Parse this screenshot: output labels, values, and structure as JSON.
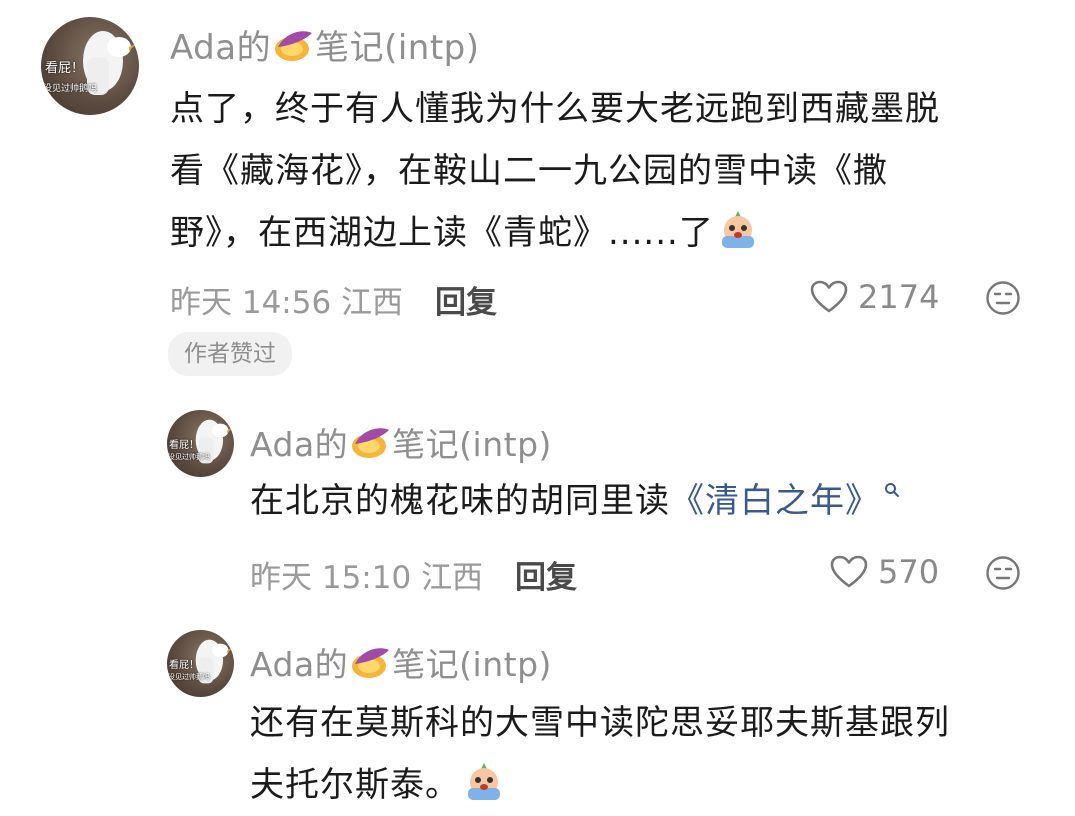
{
  "comments": [
    {
      "avatar": {
        "caption_top": "看屁！",
        "caption_bottom": "没见过帅鹅吗"
      },
      "username": "Ada的",
      "username_suffix": "笔记(intp)",
      "lines": [
        "点了，终于有人懂我为什么要大老远跑到西藏墨脱",
        "看《藏海花》，在鞍山二一九公园的雪中读《撒",
        "野》，在西湖边上读《青蛇》......了"
      ],
      "time": "昨天 14:56",
      "location": "江西",
      "reply_label": "回复",
      "likes": "2174",
      "badge": "作者赞过"
    },
    {
      "avatar": {
        "caption_top": "看屁！",
        "caption_bottom": "没见过帅鹅吗"
      },
      "username": "Ada的",
      "username_suffix": "笔记(intp)",
      "text": "在北京的槐花味的胡同里读",
      "topic": "《清白之年》",
      "time": "昨天 15:10",
      "location": "江西",
      "reply_label": "回复",
      "likes": "570"
    },
    {
      "avatar": {
        "caption_top": "看屁！",
        "caption_bottom": "没见过帅鹅吗"
      },
      "username": "Ada的",
      "username_suffix": "笔记(intp)",
      "lines": [
        "还有在莫斯科的大雪中读陀思妥耶夫斯基跟列",
        "夫托尔斯泰。"
      ]
    }
  ],
  "icons": {
    "potato": "sweet-potato-icon",
    "emoji": "crying-emoji-icon",
    "like": "heart-outline-icon",
    "dislike": "neutral-face-icon",
    "search": "search-icon"
  },
  "colors": {
    "topic_link": "#3b5a8c",
    "meta_gray": "#9a9a9a"
  }
}
